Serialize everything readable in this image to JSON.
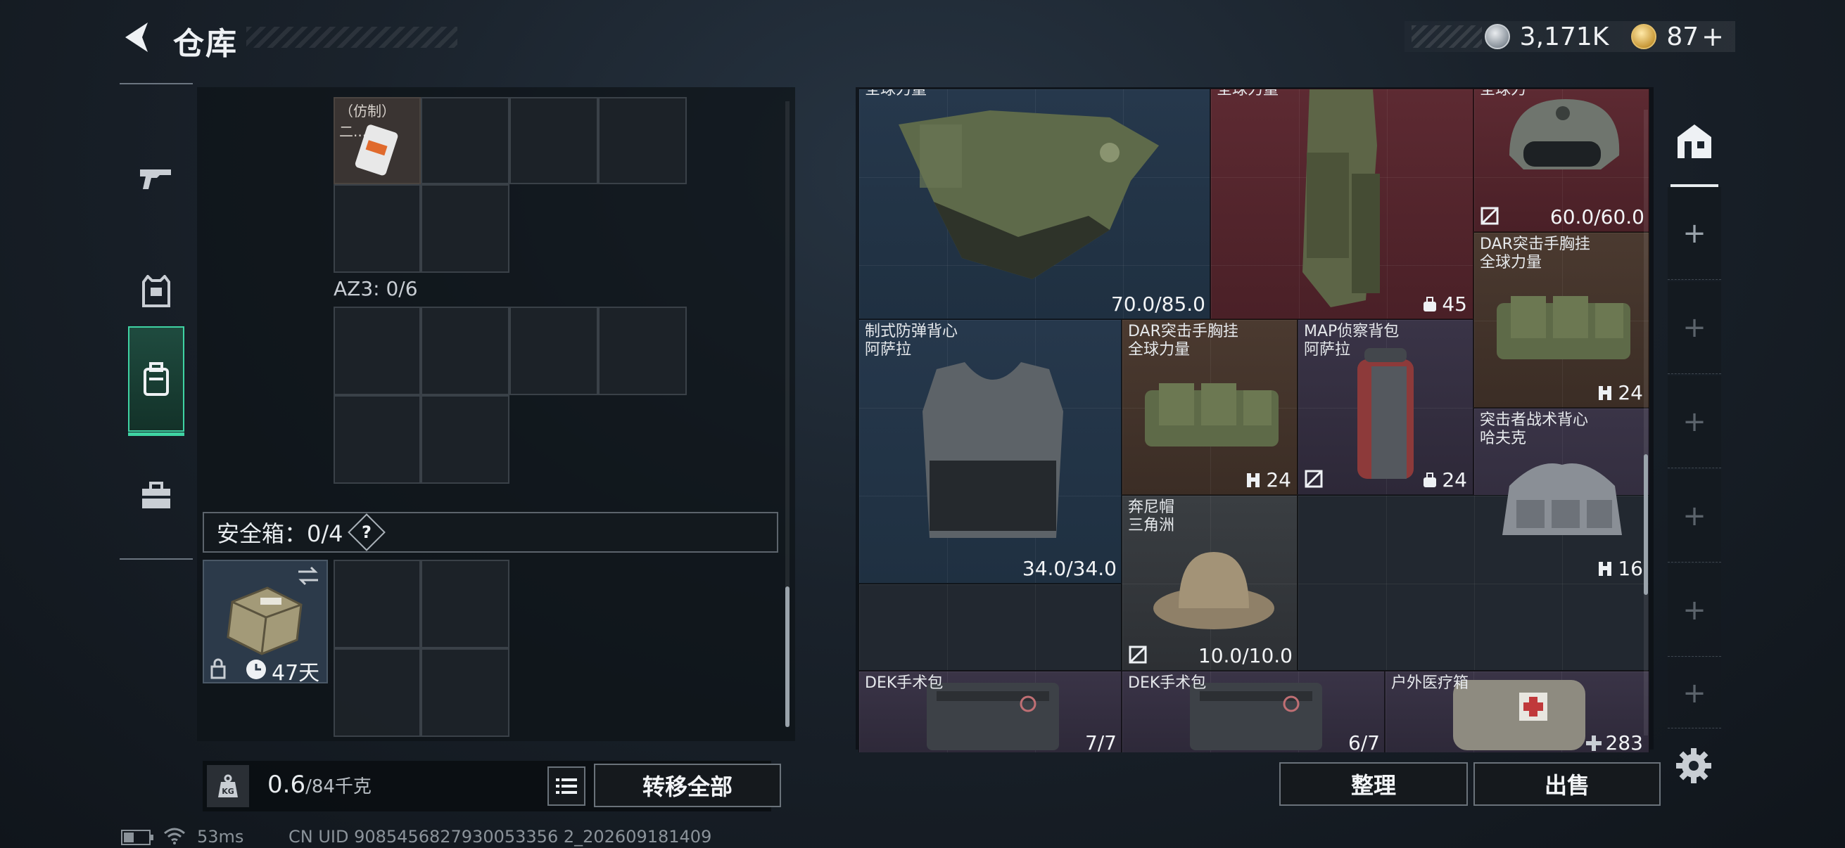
{
  "header": {
    "title": "仓库",
    "back_icon": "back-arrow-icon"
  },
  "currency": {
    "silver": "3,171K",
    "gold": "87",
    "gold_add": "+"
  },
  "rail": {
    "items": [
      {
        "name": "weapons",
        "icon": "gun-icon",
        "active": false
      },
      {
        "name": "armor",
        "icon": "armor-icon",
        "active": false
      },
      {
        "name": "backpack",
        "icon": "backpack-icon",
        "active": true
      },
      {
        "name": "toolbox",
        "icon": "toolbox-icon",
        "active": false
      }
    ]
  },
  "left_inventory": {
    "top_item_label": "（仿制）二...",
    "az3_label": "AZ3: 0/6",
    "safebox_label": "安全箱：0/4",
    "help_label": "?",
    "safebox_days": "47天",
    "weight_value": "0.6",
    "weight_total": "/84千克",
    "transfer_all": "转移全部"
  },
  "storage": {
    "items": [
      {
        "id": "vest1",
        "line1": "全球力量",
        "line2": "",
        "durability": "70.0/85.0"
      },
      {
        "id": "legbag",
        "line1": "全球力量",
        "line2": "",
        "stat": "45"
      },
      {
        "id": "helmet",
        "line1": "全球力",
        "line2": "",
        "durability": "60.0/60.0"
      },
      {
        "id": "dar1",
        "line1": "DAR突击手胸挂",
        "line2": "全球力量",
        "stat": "24"
      },
      {
        "id": "vest2",
        "line1": "制式防弹背心",
        "line2": "阿萨拉",
        "durability": "34.0/34.0"
      },
      {
        "id": "dar2",
        "line1": "DAR突击手胸挂",
        "line2": "全球力量",
        "stat": "24"
      },
      {
        "id": "map",
        "line1": "MAP侦察背包",
        "line2": "阿萨拉",
        "stat": "24"
      },
      {
        "id": "raider",
        "line1": "突击者战术背心",
        "line2": "哈夫克",
        "stat": "16"
      },
      {
        "id": "hat",
        "line1": "奔尼帽",
        "line2": "三角洲",
        "durability": "10.0/10.0"
      },
      {
        "id": "dek1",
        "line1": "DEK手术包",
        "line2": "",
        "durability": "7/7"
      },
      {
        "id": "dek2",
        "line1": "DEK手术包",
        "line2": "",
        "durability": "6/7"
      },
      {
        "id": "medkit",
        "line1": "户外医疗箱",
        "line2": "",
        "stat": "283"
      }
    ],
    "organize": "整理",
    "sell": "出售"
  },
  "status_bar": {
    "ping": "53ms",
    "uid": "CN UID 9085456827930053356 2_202609181409"
  },
  "colors": {
    "accent": "#3fd3a3",
    "blue_slot": "#26384c",
    "red_slot": "#5d2a32",
    "brown_slot": "#4b3a30",
    "purple_slot": "#3a3447"
  }
}
